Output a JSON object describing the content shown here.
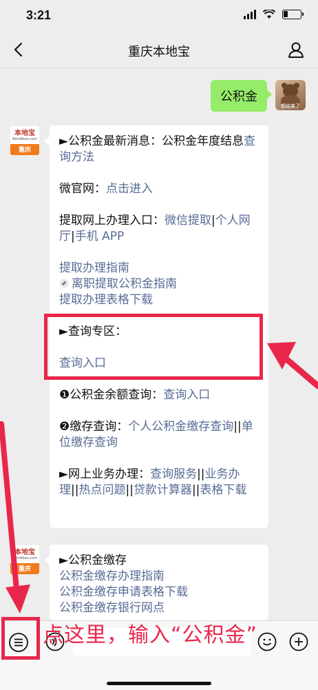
{
  "status": {
    "time": "3:21"
  },
  "nav": {
    "title": "重庆本地宝"
  },
  "user_message": {
    "text": "公积金",
    "avatar_caption": "都结束了"
  },
  "bot_avatar": {
    "logo": "本地宝",
    "url": "Bendibao.com",
    "city": "重庆"
  },
  "bubble1": {
    "news_prefix": "►公积金最新消息：公积金年度结息",
    "news_link": "查询方法",
    "site_prefix": "微官网：",
    "site_link": "点击进入",
    "withdraw_prefix": "提取网上办理入口：",
    "withdraw_link1": "微信提取",
    "sep1": "|",
    "withdraw_link2": "个人网厅",
    "sep2": "|",
    "withdraw_link3": "手机 APP",
    "guide_link": "提取办理指南",
    "leave_link": "离职提取公积金指南",
    "form_link": "提取办理表格下载",
    "query_heading": "►查询专区：",
    "query_link": "查询入口",
    "balance_prefix": "❶公积金余额查询：",
    "balance_link": "查询入口",
    "deposit_prefix": "❷缴存查询：",
    "deposit_link1": "个人公积金缴存查询",
    "deposit_sep": "||",
    "deposit_link2": "单位缴存查询",
    "online_prefix": "►网上业务办理：",
    "online_link1": "查询服务",
    "online_sep1": "||",
    "online_link2": "业务办理",
    "online_sep2": "||",
    "online_link3": "热点问题",
    "online_sep3": "||",
    "online_link4": "贷款计算器",
    "online_sep4": "||",
    "online_link5": "表格下载"
  },
  "bubble2": {
    "heading": "►公积金缴存",
    "link1": "公积金缴存办理指南",
    "link2": "公积金缴存申请表格下载",
    "link3": "公积金缴存银行网点"
  },
  "annotation": {
    "text": "点这里，输入“公积金”"
  },
  "colors": {
    "link": "#576b95",
    "user_bubble": "#95ec69",
    "annotation_red": "#e8274b"
  },
  "icons": [
    "back-icon",
    "profile-icon",
    "menu-icon",
    "voice-icon",
    "emoji-icon",
    "plus-icon"
  ]
}
